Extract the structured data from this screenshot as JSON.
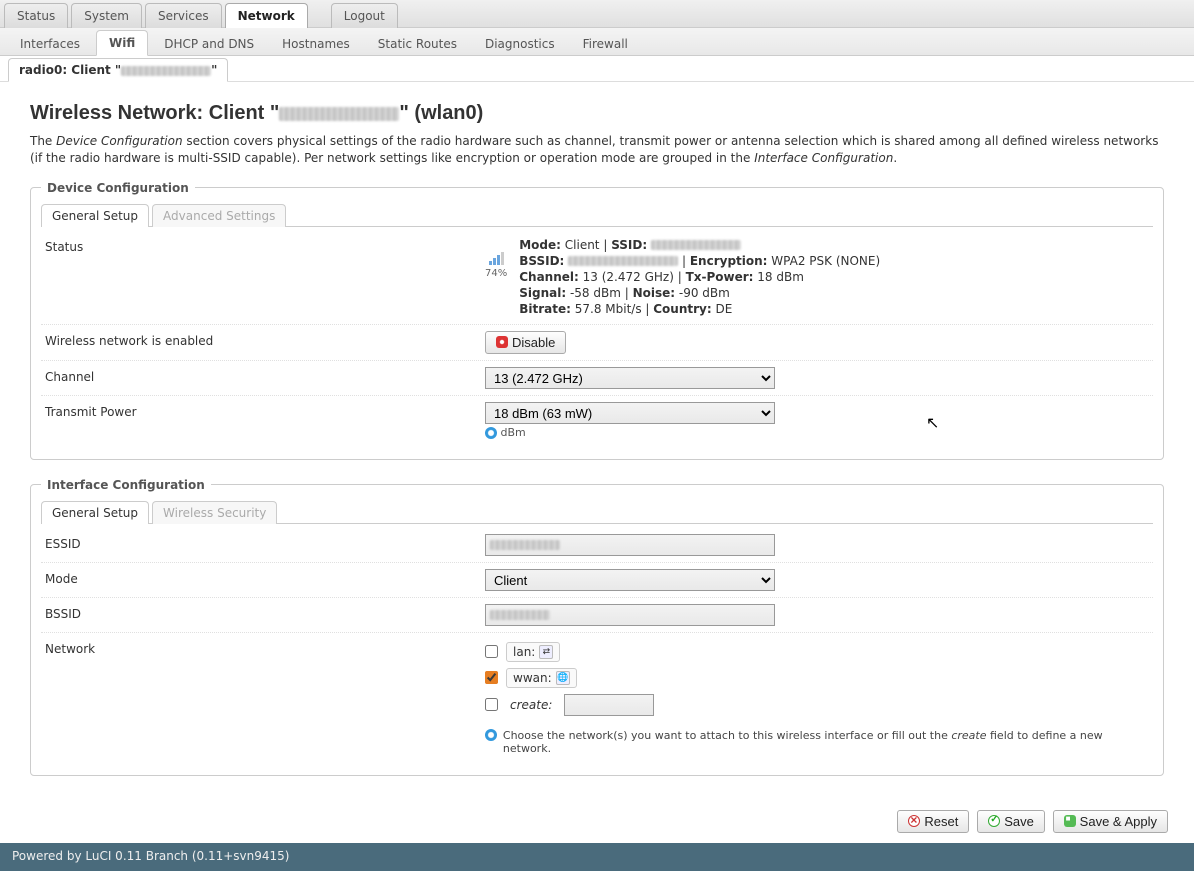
{
  "main_tabs": {
    "status": "Status",
    "system": "System",
    "services": "Services",
    "network": "Network",
    "logout": "Logout"
  },
  "sub_tabs": {
    "interfaces": "Interfaces",
    "wifi": "Wifi",
    "dhcp": "DHCP and DNS",
    "hostnames": "Hostnames",
    "routes": "Static Routes",
    "diagnostics": "Diagnostics",
    "firewall": "Firewall"
  },
  "radio_tab": {
    "prefix": "radio0: Client \"",
    "suffix": "\""
  },
  "page_title": {
    "prefix": "Wireless Network: Client \"",
    "suffix": "\" (wlan0)"
  },
  "description_pre": "The ",
  "description_em1": "Device Configuration",
  "description_mid": " section covers physical settings of the radio hardware such as channel, transmit power or antenna selection which is shared among all defined wireless networks (if the radio hardware is multi-SSID capable). Per network settings like encryption or operation mode are grouped in the ",
  "description_em2": "Interface Configuration",
  "description_end": ".",
  "device_cfg": {
    "legend": "Device Configuration",
    "tabs": {
      "general": "General Setup",
      "advanced": "Advanced Settings"
    },
    "rows": {
      "status_label": "Status",
      "signal_percent": "74%",
      "mode_lbl": "Mode:",
      "mode_val": " Client | ",
      "ssid_lbl": "SSID:",
      "bssid_lbl": "BSSID:",
      "enc_sep": " | ",
      "enc_lbl": "Encryption:",
      "enc_val": " WPA2 PSK (NONE)",
      "chan_lbl": "Channel:",
      "chan_val": " 13 (2.472 GHz) | ",
      "txp_lbl": "Tx-Power:",
      "txp_val": " 18 dBm",
      "sig_lbl": "Signal:",
      "sig_val": " -58 dBm | ",
      "noise_lbl": "Noise:",
      "noise_val": " -90 dBm",
      "bit_lbl": "Bitrate:",
      "bit_val": " 57.8 Mbit/s | ",
      "cty_lbl": "Country:",
      "cty_val": " DE",
      "enabled_label": "Wireless network is enabled",
      "disable_btn": "Disable",
      "channel_label": "Channel",
      "channel_opt": "13 (2.472 GHz)",
      "txpower_label": "Transmit Power",
      "txpower_opt": "18 dBm (63 mW)",
      "txpower_unit": " dBm"
    }
  },
  "iface_cfg": {
    "legend": "Interface Configuration",
    "tabs": {
      "general": "General Setup",
      "security": "Wireless Security"
    },
    "rows": {
      "essid_label": "ESSID",
      "mode_label": "Mode",
      "mode_opt": "Client",
      "bssid_label": "BSSID",
      "network_label": "Network",
      "opt_lan": "lan:",
      "opt_wwan": "wwan:",
      "opt_create": "create:",
      "help_pre": "Choose the network(s) you want to attach to this wireless interface or fill out the ",
      "help_em": "create",
      "help_post": " field to define a new network."
    }
  },
  "actions": {
    "reset": "Reset",
    "save": "Save",
    "saveapply": "Save & Apply"
  },
  "footer": "Powered by LuCI 0.11 Branch (0.11+svn9415)"
}
